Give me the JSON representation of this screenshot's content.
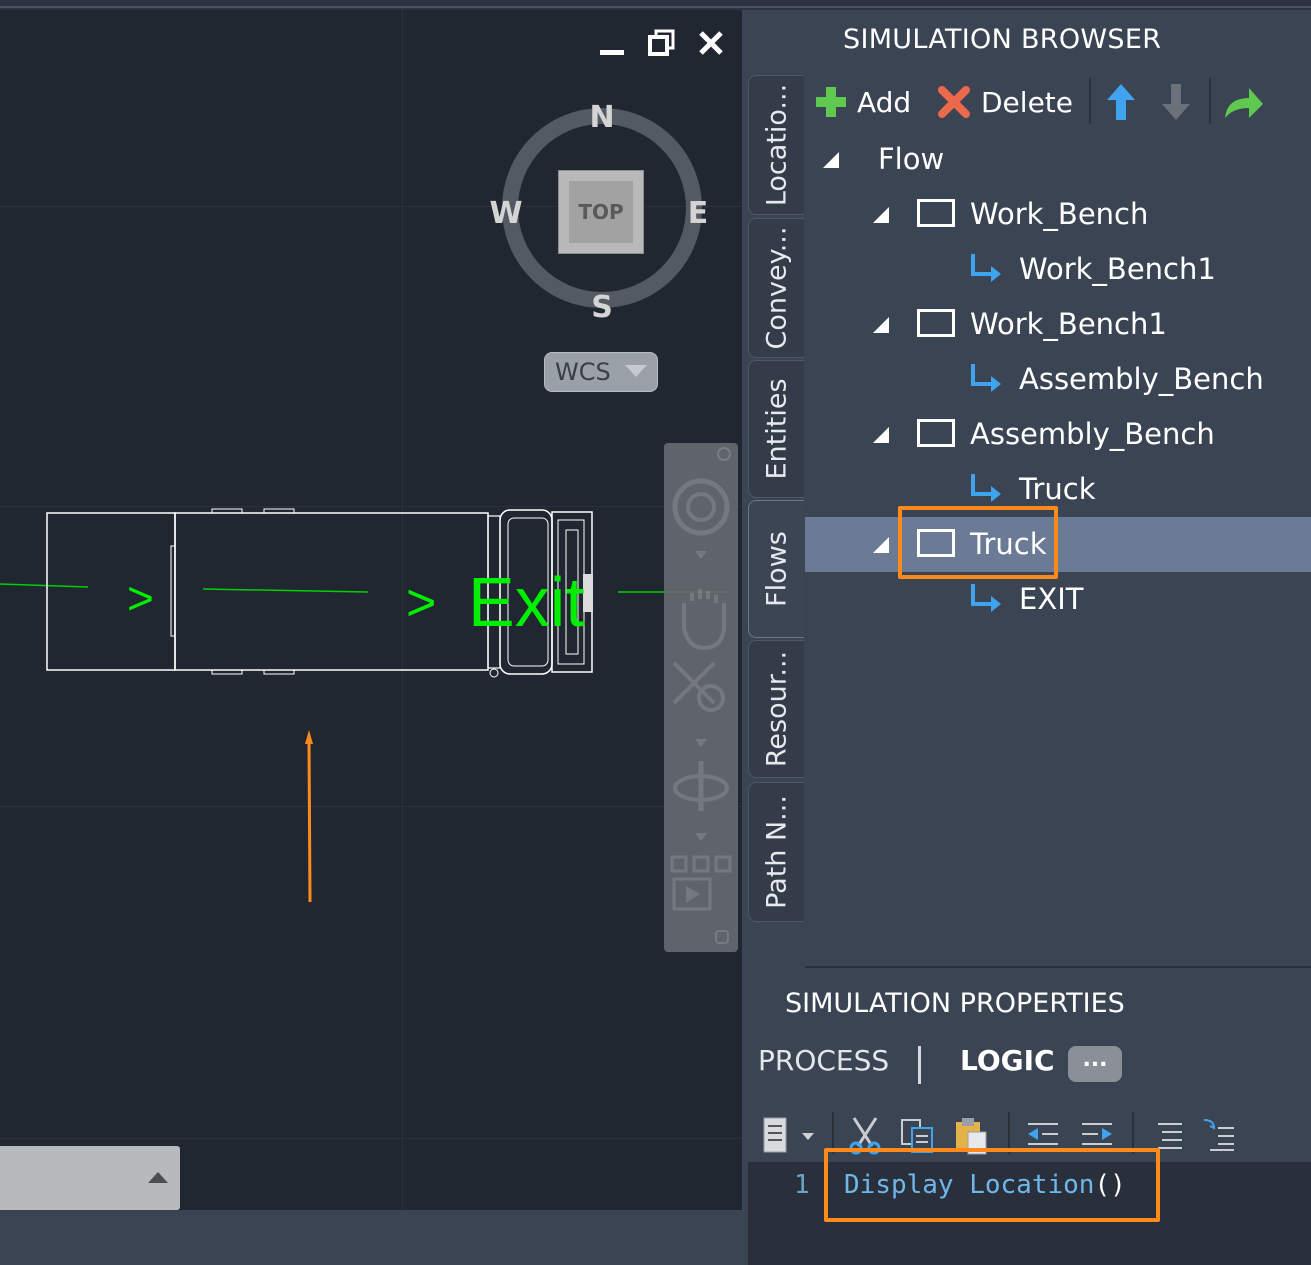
{
  "viewport": {
    "window_controls": {
      "minimize": "minimize",
      "restore": "restore",
      "close": "close"
    },
    "compass": {
      "north": "N",
      "south": "S",
      "east": "E",
      "west": "W",
      "cube_face": "TOP"
    },
    "ucs_menu": "WCS",
    "drawing": {
      "arrow_1": ">",
      "arrow_2": ">",
      "exit_label": "Exit",
      "line_color": "#00ee00",
      "arrow_color": "#ff8a1c"
    },
    "navigation_bar": {
      "tools": [
        "steering-wheel-icon",
        "pan-hand-icon",
        "zoom-extents-icon",
        "orbit-icon",
        "showmotion-icon"
      ]
    }
  },
  "side_tabs": [
    {
      "label": "Locatio...",
      "active": false
    },
    {
      "label": "Convey...",
      "active": false
    },
    {
      "label": "Entities",
      "active": false
    },
    {
      "label": "Flows",
      "active": true
    },
    {
      "label": "Resour...",
      "active": false
    },
    {
      "label": "Path N...",
      "active": false
    }
  ],
  "browser": {
    "title": "SIMULATION BROWSER",
    "toolbar": {
      "add": "Add",
      "delete": "Delete",
      "icons": [
        "plus-icon",
        "delete-x-icon",
        "move-up-icon",
        "move-down-icon",
        "redo-arrow-icon"
      ]
    },
    "tree": [
      {
        "label": "Flow",
        "level": 0,
        "type": "root"
      },
      {
        "label": "Work_Bench",
        "level": 1,
        "type": "location"
      },
      {
        "label": "Work_Bench1",
        "level": 2,
        "type": "route"
      },
      {
        "label": "Work_Bench1",
        "level": 1,
        "type": "location"
      },
      {
        "label": "Assembly_Bench",
        "level": 2,
        "type": "route"
      },
      {
        "label": "Assembly_Bench",
        "level": 1,
        "type": "location"
      },
      {
        "label": "Truck",
        "level": 2,
        "type": "route"
      },
      {
        "label": "Truck",
        "level": 1,
        "type": "location",
        "selected": true
      },
      {
        "label": "EXIT",
        "level": 2,
        "type": "route"
      }
    ]
  },
  "properties": {
    "title": "SIMULATION PROPERTIES",
    "tabs": {
      "process": "PROCESS",
      "logic": "LOGIC",
      "more": "..."
    },
    "active_tab": "LOGIC",
    "editor": {
      "line_number": "1",
      "code_text": "Display Location",
      "code_parens": "()"
    }
  },
  "colors": {
    "highlight": "#ff8a1c",
    "selected_row": "#6b7a95",
    "panel_bg": "#3b4453",
    "viewport_bg": "#212731",
    "code": "#6fb7ea"
  }
}
